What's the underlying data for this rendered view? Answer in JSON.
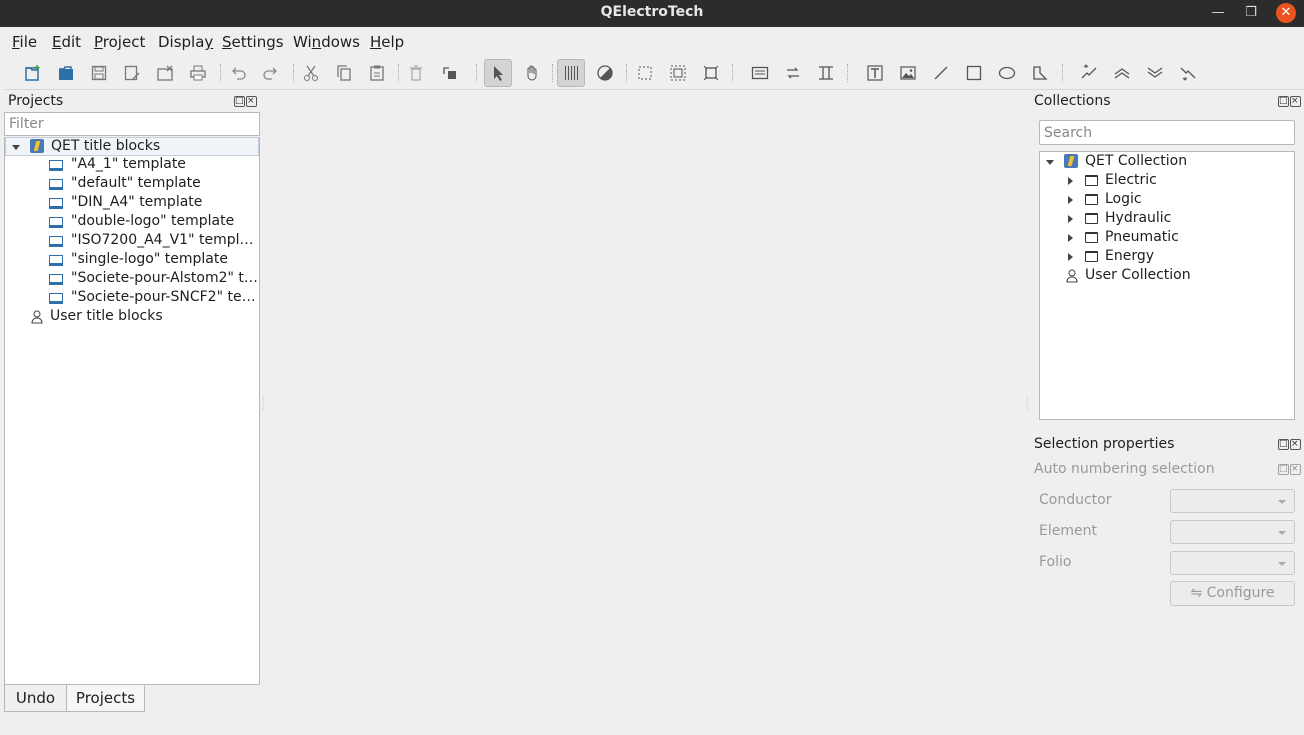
{
  "window": {
    "title": "QElectroTech"
  },
  "menu": [
    {
      "label_pre": "",
      "label_u": "F",
      "label_post": "ile"
    },
    {
      "label_pre": "",
      "label_u": "E",
      "label_post": "dit"
    },
    {
      "label_pre": "",
      "label_u": "P",
      "label_post": "roject"
    },
    {
      "label_pre": "Displa",
      "label_u": "y",
      "label_post": ""
    },
    {
      "label_pre": "",
      "label_u": "S",
      "label_post": "ettings"
    },
    {
      "label_pre": "Wi",
      "label_u": "n",
      "label_post": "dows"
    },
    {
      "label_pre": "",
      "label_u": "H",
      "label_post": "elp"
    }
  ],
  "toolbar": {
    "icons": [
      "new-project-icon",
      "open-project-icon",
      "save-icon",
      "save-as-icon",
      "close-project-icon",
      "print-icon",
      "undo-icon",
      "redo-icon",
      "cut-icon",
      "copy-icon",
      "paste-icon",
      "delete-icon",
      "rotate-icon",
      "select-mode-icon",
      "pan-mode-icon",
      "grid-icon",
      "color-icon",
      "zoom-fit-icon",
      "zoom-content-icon",
      "zoom-reset-icon",
      "titleblock-icon",
      "swap-icon",
      "conductor-icon",
      "add-text-icon",
      "add-image-icon",
      "add-line-icon",
      "add-rectangle-icon",
      "add-ellipse-icon",
      "add-polygon-icon",
      "bring-forward-icon",
      "raise-icon",
      "lower-icon",
      "send-backward-icon"
    ]
  },
  "projects": {
    "title": "Projects",
    "filter_placeholder": "Filter",
    "root": "QET title blocks",
    "templates": [
      "\"A4_1\" template",
      "\"default\" template",
      "\"DIN_A4\" template",
      "\"double-logo\" template",
      "\"ISO7200_A4_V1\" templ…",
      "\"single-logo\" template",
      "\"Societe-pour-Alstom2\" t…",
      "\"Societe-pour-SNCF2\" te…"
    ],
    "user": "User title blocks"
  },
  "tabs": {
    "undo": "Undo",
    "projects": "Projects"
  },
  "collections": {
    "title": "Collections",
    "search_placeholder": "Search",
    "root": "QET Collection",
    "folders": [
      "Electric",
      "Logic",
      "Hydraulic",
      "Pneumatic",
      "Energy"
    ],
    "user": "User Collection"
  },
  "selection": {
    "title": "Selection properties",
    "auto_title": "Auto numbering selection",
    "conductor": "Conductor",
    "element": "Element",
    "folio": "Folio",
    "configure": "Configure"
  }
}
